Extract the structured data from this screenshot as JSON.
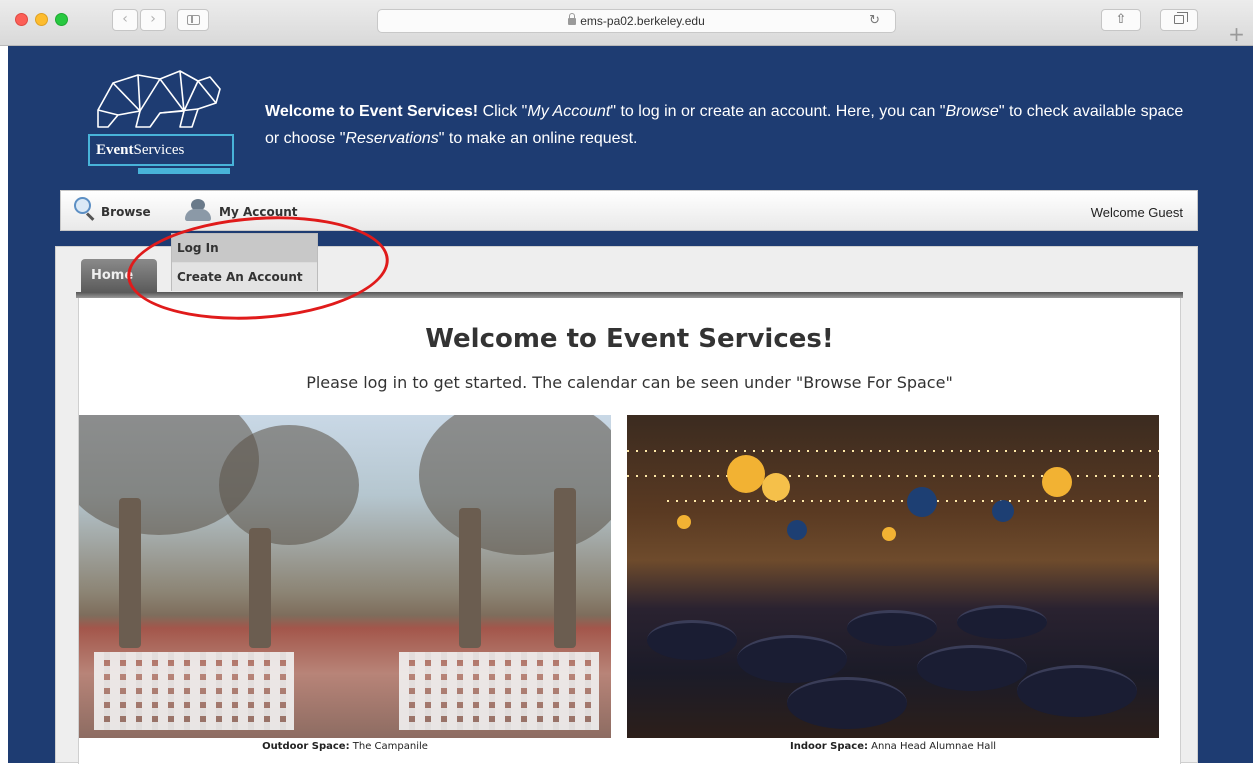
{
  "browser": {
    "url": "ems-pa02.berkeley.edu",
    "nav_back_glyph": "‹",
    "nav_forward_glyph": "›",
    "reload_glyph": "↻",
    "share_glyph": "⇧",
    "new_tab_glyph": "+"
  },
  "header": {
    "logo_text_bold": "Event",
    "logo_text_regular": "Services",
    "welcome_bold": "Welcome to Event Services!",
    "welcome_part1": " Click \"",
    "welcome_account": "My Account",
    "welcome_part2": "\" to log in or create an account. Here, you can \"",
    "welcome_browse": "Browse",
    "welcome_part3": "\" to check available space or choose \"",
    "welcome_reservations": "Reservations",
    "welcome_part4": "\" to make an online request.",
    "accent_color": "#48b3d9",
    "brand_color": "#1e3c72"
  },
  "menu": {
    "browse_label": "Browse",
    "account_label": "My Account",
    "welcome_guest": "Welcome Guest"
  },
  "dropdown": {
    "login_label": "Log In",
    "create_label": "Create An Account"
  },
  "content": {
    "home_tab": "Home",
    "title": "Welcome to Event Services!",
    "subtitle": "Please log in to get started. The calendar can be seen under \"Browse For Space\"",
    "captions": [
      {
        "label": "Outdoor Space:",
        "value": " The Campanile"
      },
      {
        "label": "Indoor Space:",
        "value": " Anna Head Alumnae Hall"
      }
    ]
  },
  "annotation": {
    "color": "#e01b1b"
  }
}
